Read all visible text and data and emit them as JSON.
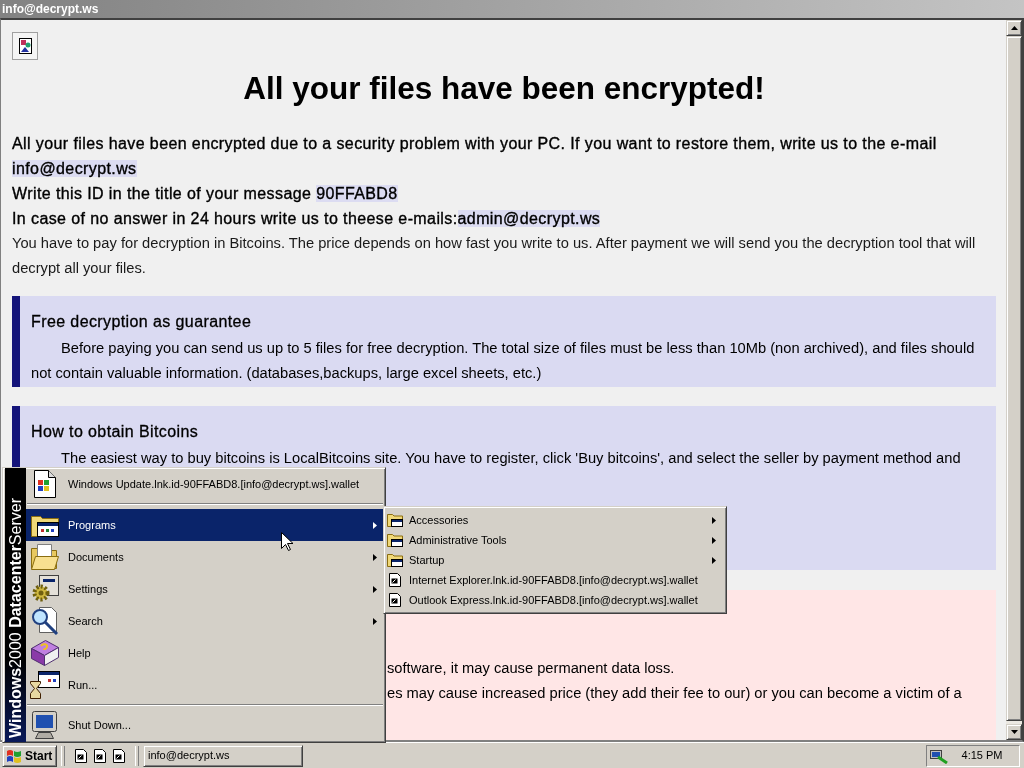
{
  "window": {
    "title": "info@decrypt.ws",
    "active": false
  },
  "page": {
    "heading": "All your files have been encrypted!",
    "paragraphs": [
      {
        "text": "All your files have been encrypted due to a security problem with your PC. If you want to restore them, write us to the e-mail ",
        "marked": "info@decrypt.ws",
        "emphasis": true
      },
      {
        "text": "Write this ID in the title of your message ",
        "marked": "90FFABD8",
        "emphasis": true
      },
      {
        "text": "In case of no answer in 24 hours write us to theese e-mails:",
        "marked": "admin@decrypt.ws",
        "emphasis": true
      },
      {
        "text": "You have to pay for decryption in Bitcoins. The price depends on how fast you write to us. After payment we will send you the decryption tool that will decrypt all your files.",
        "emphasis": false
      }
    ],
    "notices": [
      {
        "kind": "info",
        "title": "Free decryption as guarantee",
        "text": "Before paying you can send us up to 5 files for free decryption. The total size of files must be less than 10Mb (non archived), and files should not contain valuable information. (databases,backups, large excel sheets, etc.)"
      },
      {
        "kind": "info",
        "title": "How to obtain Bitcoins",
        "text": "The easiest way to buy bitcoins is LocalBitcoins site. You have to register, click 'Buy bitcoins', and select the seller by payment method and"
      },
      {
        "kind": "warning",
        "lines": [
          "software, it may cause permanent data loss.",
          "es may cause increased price (they add their fee to our) or you can become a victim of a"
        ]
      }
    ]
  },
  "start_menu": {
    "banner": "**Windows**2000 **Datacenter**Server",
    "groups": [
      [
        {
          "label": "Windows Update.lnk.id-90FFABD8.[info@decrypt.ws].wallet",
          "selected": false,
          "has_submenu": false
        }
      ],
      [
        {
          "label": "Programs",
          "selected": true,
          "has_submenu": true
        },
        {
          "label": "Documents",
          "selected": false,
          "has_submenu": true
        },
        {
          "label": "Settings",
          "selected": false,
          "has_submenu": true
        },
        {
          "label": "Search",
          "selected": false,
          "has_submenu": true
        },
        {
          "label": "Help",
          "selected": false,
          "has_submenu": false
        },
        {
          "label": "Run...",
          "selected": false,
          "has_submenu": false
        }
      ],
      [
        {
          "label": "Shut Down...",
          "selected": false,
          "has_submenu": false
        }
      ]
    ],
    "submenu": [
      {
        "label": "Accessories",
        "selected": false,
        "has_submenu": true
      },
      {
        "label": "Administrative Tools",
        "selected": false,
        "has_submenu": true
      },
      {
        "label": "Startup",
        "selected": false,
        "has_submenu": true
      },
      {
        "label": "Internet Explorer.lnk.id-90FFABD8.[info@decrypt.ws].wallet",
        "selected": false,
        "has_submenu": false
      },
      {
        "label": "Outlook Express.lnk.id-90FFABD8.[info@decrypt.ws].wallet",
        "selected": false,
        "has_submenu": false
      }
    ]
  },
  "taskbar": {
    "start": "Start",
    "tasks": [
      {
        "label": "info@decrypt.ws",
        "selected": false
      }
    ],
    "clock": "4:15 PM"
  }
}
